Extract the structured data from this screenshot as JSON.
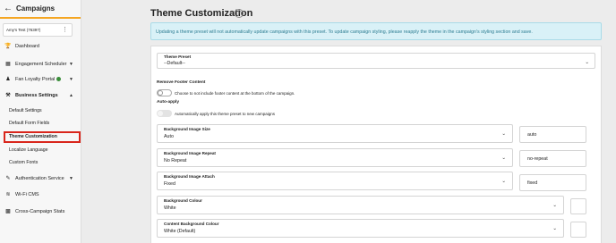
{
  "sidebar": {
    "back_icon": "arrow-left-icon",
    "title": "Campaigns",
    "account": "Amy's Test (76397)",
    "nav": [
      {
        "label": "Dashboard",
        "icon": "trophy-icon"
      },
      {
        "label": "Engagement Scheduler",
        "icon": "calendar-icon"
      },
      {
        "label": "Fan Loyalty Portal",
        "icon": "person-icon"
      },
      {
        "label": "Business Settings",
        "icon": "wrench-icon"
      },
      {
        "label": "Authentication Service",
        "icon": "edit-icon"
      },
      {
        "label": "Wi-Fi CMS",
        "icon": "wifi-icon"
      },
      {
        "label": "Cross-Campaign Stats",
        "icon": "bar-chart-icon"
      }
    ],
    "sub": [
      {
        "label": "Default Settings"
      },
      {
        "label": "Default Form Fields"
      },
      {
        "label": "Theme Customization"
      },
      {
        "label": "Localize Language"
      },
      {
        "label": "Custom Fonts"
      }
    ]
  },
  "main": {
    "title": "Theme Customization",
    "help": "?",
    "info": "Updating a theme preset will not automatically update campaigns with this preset. To update campaign styling, please reapply the theme in the campaign's styling section and save.",
    "preset": {
      "label": "Theme Preset",
      "value": "--Default--"
    },
    "remove_footer": {
      "label": "Remove Footer Content",
      "text": "Choose to not include footer content at the bottom of the campaign."
    },
    "auto_apply": {
      "label": "Auto-apply",
      "text": "Automatically apply this theme preset to new campaigns"
    },
    "bg_size": {
      "label": "Background Image Size",
      "value": "Auto",
      "side": "auto"
    },
    "bg_repeat": {
      "label": "Background Image Repeat",
      "value": "No Repeat",
      "side": "no-repeat"
    },
    "bg_attach": {
      "label": "Background Image Attach",
      "value": "Fixed",
      "side": "fixed"
    },
    "bg_colour": {
      "label": "Background Colour",
      "value": "White"
    },
    "content_bg_colour": {
      "label": "Content Background Colour",
      "value": "White (Default)"
    }
  }
}
